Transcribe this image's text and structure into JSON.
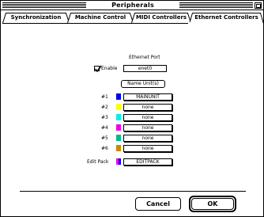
{
  "window": {
    "title": "Peripherals"
  },
  "tabs": [
    {
      "label": "Synchronization"
    },
    {
      "label": "Machine Control"
    },
    {
      "label": "MIDI Controllers"
    },
    {
      "label": "Ethernet Controllers",
      "selected": true
    }
  ],
  "ethernet": {
    "port_label": "Ethernet Port",
    "enable_label": "Enable",
    "enabled": true,
    "port_value": "enet0",
    "name_units_button": "Name Unit(s)"
  },
  "units": [
    {
      "label": "#1",
      "color": "#0000ee",
      "name": "MAINUNIT"
    },
    {
      "label": "#2",
      "color": "#ffff00",
      "name": "none"
    },
    {
      "label": "#3",
      "color": "#00eeee",
      "name": "none"
    },
    {
      "label": "#4",
      "color": "#ee00ee",
      "name": "none"
    },
    {
      "label": "#5",
      "color": "#00bb88",
      "name": "none"
    },
    {
      "label": "#6",
      "color": "#cc8800",
      "name": "none"
    }
  ],
  "edit_pack": {
    "label": "Edit Pack",
    "colors": [
      "#ee00ee",
      "#0000ee"
    ],
    "name": "EDITPACK"
  },
  "buttons": {
    "cancel": "Cancel",
    "ok": "OK"
  }
}
